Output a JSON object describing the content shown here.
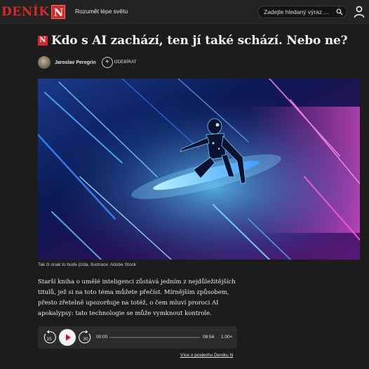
{
  "header": {
    "logo_text": "DENÍK",
    "logo_badge": "N",
    "tagline": "Rozumět lépe světu",
    "search_placeholder": "Zadejte hledaný výraz ...",
    "icons": {
      "search": "search-icon",
      "user": "user-icon"
    }
  },
  "article": {
    "badge": "N",
    "title": "Kdo s AI zachází, ten jí také schází. Nebo ne?",
    "author": {
      "name": "Jaroslav Peregrin",
      "follow_label": "ODEBÍRAT"
    },
    "caption": "Tak či onak to bude jízda. Ilustrace: Adobe Stock",
    "lead": "Starší kniha o umělé inteligenci zůstává jedním z nejdůležitějších titulů, jež si na toto téma můžete přečíst. Mírnějším způsobem, přesto zřetelně upozorňuje na totéž, o čem mluví proroci AI apokalypsy: tato technologie se může vymknout kontrole."
  },
  "player": {
    "back_label": "15",
    "forward_label": "30",
    "current_time": "00:00",
    "duration": "08:54",
    "speed": "1.00×",
    "progress": 0,
    "icons": {
      "back": "rewind-15-icon",
      "play": "play-icon",
      "forward": "forward-30-icon"
    }
  },
  "footer_link": "Více o poslechu Deníku N",
  "colors": {
    "brand": "#d42a2a",
    "background": "#1c1c1c",
    "player_bg": "#2b2b2b"
  }
}
